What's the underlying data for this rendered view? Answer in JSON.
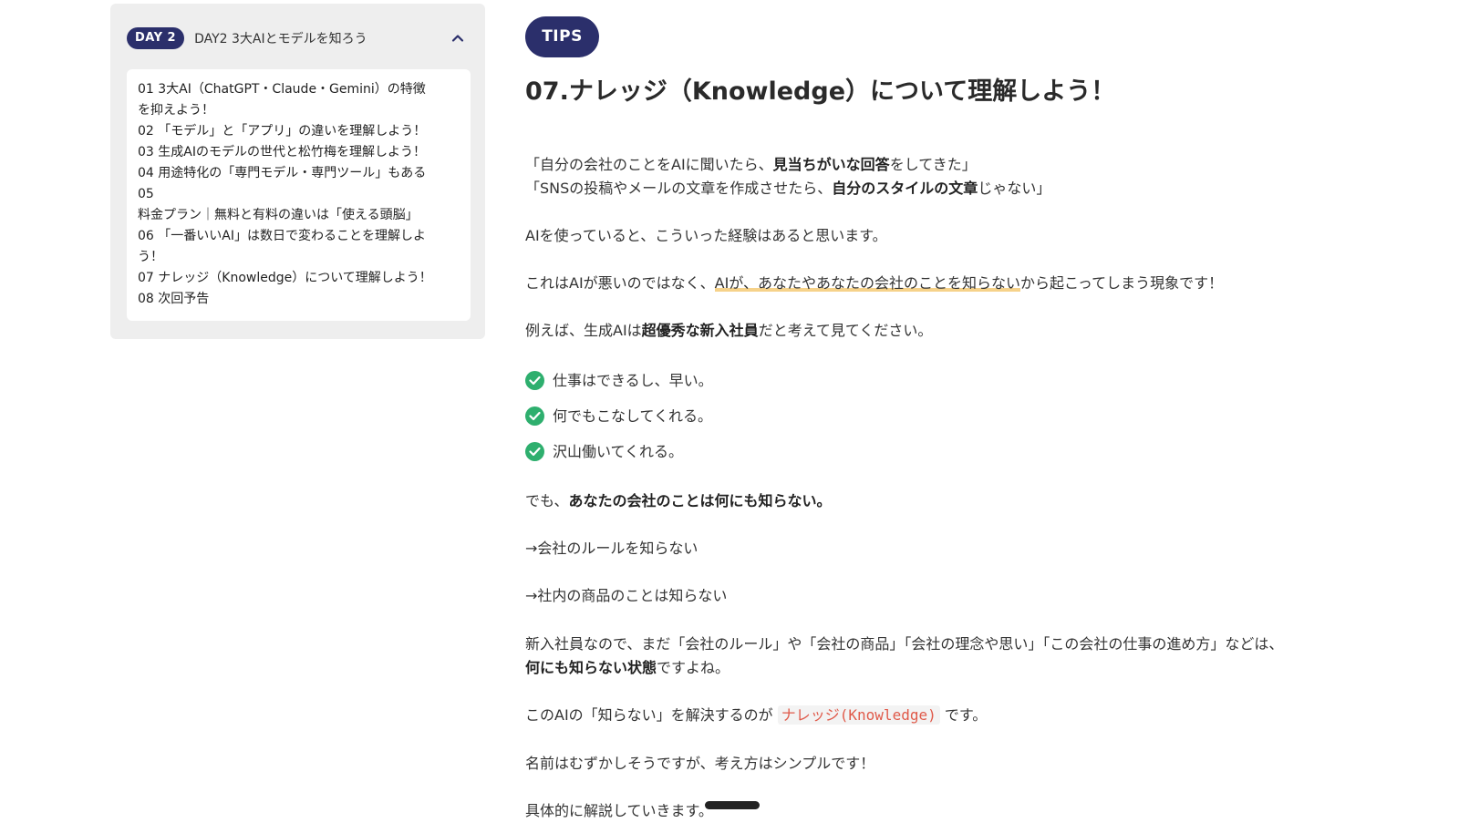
{
  "sidebar": {
    "day_badge": "DAY 2",
    "day_title": "DAY2 3大AIとモデルを知ろう",
    "lessons": [
      {
        "line1": "01 3大AI（ChatGPT・Claude・Gemini）の特徴",
        "line2": "を抑えよう！"
      },
      {
        "line1": "02 「モデル」と「アプリ」の違いを理解しよう！"
      },
      {
        "line1": "03 生成AIのモデルの世代と松竹梅を理解しよう！"
      },
      {
        "line1": "04 用途特化の「専門モデル・専門ツール」もある"
      },
      {
        "line1": "05",
        "line2": "料金プラン｜無料と有料の違いは「使える頭脳」"
      },
      {
        "line1": "06 「一番いいAI」は数日で変わることを理解しよ",
        "line2": "う！"
      },
      {
        "line1": "07 ナレッジ（Knowledge）について理解しよう！"
      },
      {
        "line1": "08 次回予告"
      }
    ]
  },
  "main": {
    "tips_badge": "TIPS",
    "title": "07.ナレッジ（Knowledge）について理解しよう！",
    "quote1": {
      "pre": "「自分の会社のことをAIに聞いたら、",
      "bold": "見当ちがいな回答",
      "post": "をしてきた」"
    },
    "quote2": {
      "pre": "「SNSの投稿やメールの文章を作成させたら、",
      "bold": "自分のスタイルの文章",
      "post": "じゃない」"
    },
    "p_experience": "AIを使っていると、こういった経験はあると思います。",
    "p_reason": {
      "pre": "これはAIが悪いのではなく、",
      "underline": "AIが、あなたやあなたの会社のことを知らない",
      "post": "から起こってしまう現象です！"
    },
    "p_example": {
      "pre": "例えば、生成AIは",
      "bold": "超優秀な新入社員",
      "post": "だと考えて見てください。"
    },
    "checks": [
      "仕事はできるし、早い。",
      "何でもこなしてくれる。",
      "沢山働いてくれる。"
    ],
    "p_but": {
      "pre": "でも、",
      "bold": "あなたの会社のことは何にも知らない。"
    },
    "p_rules": "→会社のルールを知らない",
    "p_products": "→社内の商品のことは知らない",
    "p_newhire1": "新入社員なので、まだ「会社のルール」や「会社の商品」「会社の理念や思い」「この会社の仕事の進め方」などは、",
    "p_newhire2": {
      "bold": "何にも知らない状態",
      "post": "ですよね。"
    },
    "p_solution": {
      "pre": "このAIの「知らない」を解決するのが",
      "code": "ナレッジ(Knowledge)",
      "post": "です。"
    },
    "p_simple": "名前はむずかしそうですが、考え方はシンプルです！",
    "p_explain": "具体的に解説していきます。"
  },
  "colors": {
    "accent": "#2b2f6b",
    "check": "#2eaf6e",
    "code_text": "#e05a4a",
    "underline": "#f6d28a"
  }
}
